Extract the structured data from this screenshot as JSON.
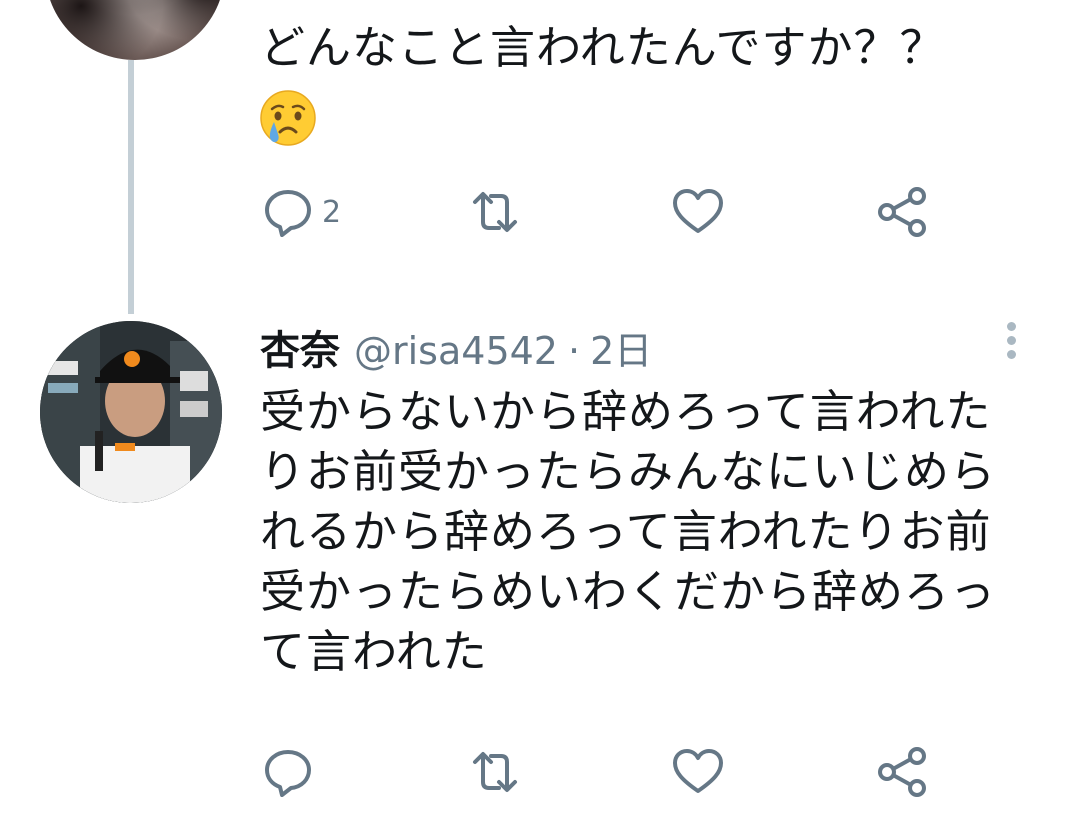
{
  "tweets": [
    {
      "text": "どんなこと言われたんですか？？",
      "emoji": "crying-face",
      "reply_count": "2"
    },
    {
      "name": "杏奈",
      "handle": "@risa4542",
      "separator": "·",
      "time": "2日",
      "text": "受からないから辞めろって言われたりお前受かったらみんなにいじめられるから辞めろって言われたりお前受かったらめいわくだから辞めろって言われた"
    }
  ],
  "colors": {
    "text": "#14171a",
    "secondary": "#657786",
    "thread_line": "#c4cfd6",
    "more_dots": "#aab8c2"
  },
  "icons": [
    "reply-icon",
    "retweet-icon",
    "like-icon",
    "share-icon",
    "more-icon"
  ]
}
